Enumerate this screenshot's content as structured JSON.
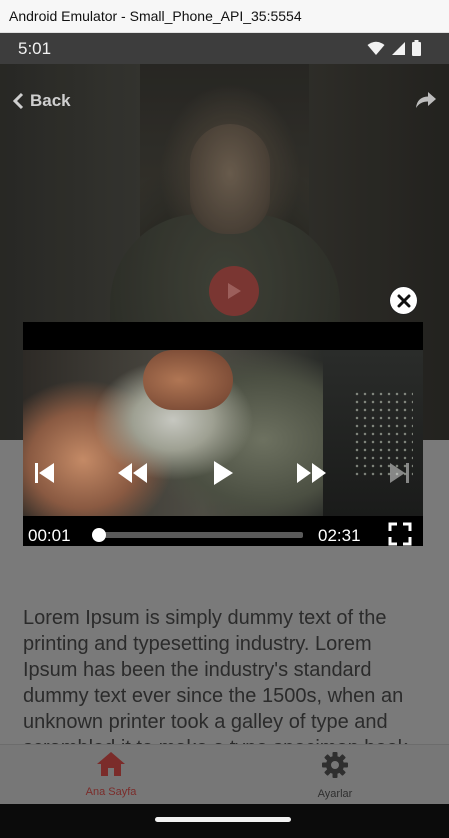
{
  "window": {
    "title": "Android Emulator - Small_Phone_API_35:5554"
  },
  "status_bar": {
    "time": "5:01",
    "icons": [
      "wifi-icon",
      "signal-icon",
      "battery-icon"
    ]
  },
  "header": {
    "back_label": "Back",
    "back_icon": "chevron-left-icon",
    "share_icon": "share-icon"
  },
  "hero": {
    "play_icon": "play-icon",
    "accent_color": "#7a3632"
  },
  "video_player": {
    "current_time": "00:01",
    "duration": "02:31",
    "progress": 0.007,
    "controls": [
      "skip-previous-icon",
      "rewind-icon",
      "play-icon",
      "fast-forward-icon",
      "skip-next-icon",
      "fullscreen-icon"
    ],
    "close_icon": "close-icon"
  },
  "content": {
    "body": "Lorem Ipsum is simply dummy text of the printing and typesetting industry. Lorem Ipsum has been the industry's standard dummy text ever since the 1500s, when an unknown printer took a galley of type and scrambled it to make a type specimen book."
  },
  "bottom_nav": {
    "items": [
      {
        "label": "Ana Sayfa",
        "icon": "home-icon",
        "active": true
      },
      {
        "label": "Ayarlar",
        "icon": "gear-icon",
        "active": false
      }
    ],
    "active_color": "#7b2c2a"
  }
}
